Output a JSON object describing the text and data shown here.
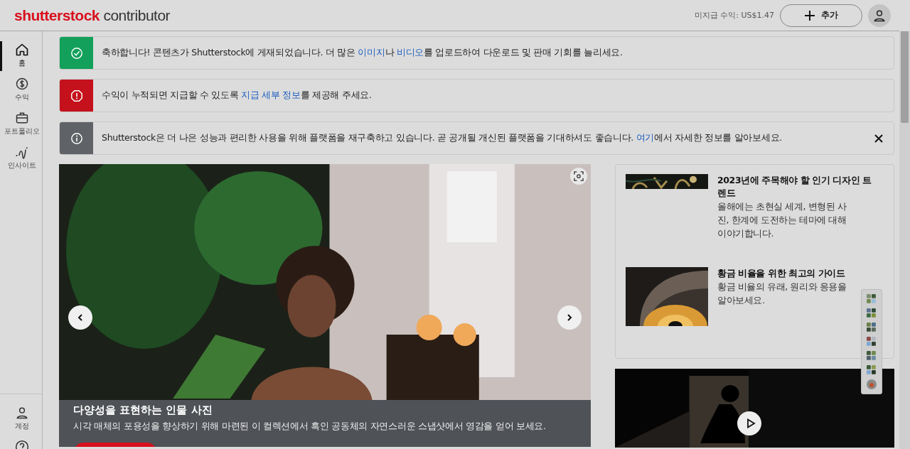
{
  "header": {
    "logo_brand": "shutterstock",
    "logo_product": "contributor",
    "earnings": "미지급 수익: US$1.47",
    "add_button": "추가"
  },
  "sidebar": {
    "items": [
      {
        "label": "홈",
        "kind": "home",
        "selected": true
      },
      {
        "label": "수익",
        "kind": "dollar",
        "selected": false
      },
      {
        "label": "포트폴리오",
        "kind": "briefcase",
        "selected": false
      },
      {
        "label": "인사이트",
        "kind": "insight",
        "selected": false
      }
    ],
    "bottom_items": [
      {
        "label": "계정",
        "kind": "person"
      },
      {
        "kind": "help"
      }
    ]
  },
  "alerts": [
    {
      "kind": "success",
      "closable": false,
      "parts": [
        "축하합니다! 콘텐츠가 Shutterstock에 게재되었습니다. 더 많은 ",
        "이미지",
        "나 ",
        "비디오",
        "를 업로드하여 다운로드 및 판매 기회를 늘리세요."
      ]
    },
    {
      "kind": "error",
      "closable": false,
      "parts": [
        "수익이 누적되면 지급할 수 있도록 ",
        "지급 세부 정보",
        "를 제공해 주세요."
      ]
    },
    {
      "kind": "info",
      "closable": true,
      "parts": [
        "Shutterstock은 더 나은 성능과 편리한 사용을 위해 플랫폼을 재구축하고 있습니다. 곧 공개될 개신된 플랫폼을 기대하셔도 좋습니다. ",
        "여기",
        "에서 자세한 정보를 알아보세요."
      ]
    }
  ],
  "hero": {
    "title": "다양성을 표현하는 인물 사진",
    "description": "시각 매체의 포용성을 향상하기 위해 마련된 이 컬렉션에서 흑인 공동체의 자연스러운 스냅샷에서 영감을 얻어 보세요."
  },
  "articles": [
    {
      "title": "2023년에 주목해야 할 인기 디자인 트렌드",
      "description": "올해에는 초현실 세계, 변형된 사진, 한계에 도전하는 테마에 대해 이야기합니다.",
      "kind": "pattern"
    },
    {
      "title": "황금 비율을 위한 최고의 가이드",
      "description": "황금 비율의 유래, 원리와 응용을 알아보세요.",
      "kind": "stairs"
    }
  ],
  "video": {
    "playable": true
  }
}
